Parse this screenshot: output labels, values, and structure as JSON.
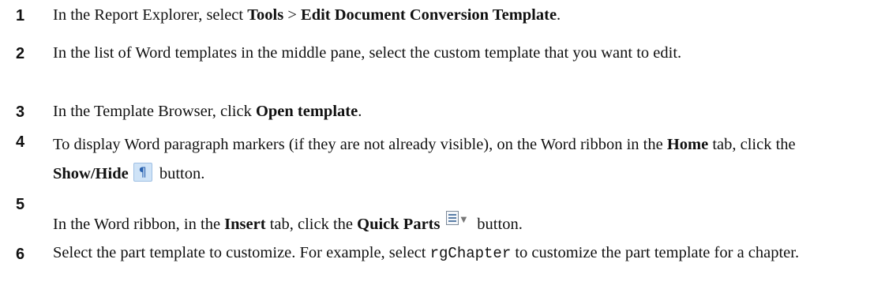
{
  "steps": [
    {
      "number": "1",
      "prefix": "In the Report Explorer, select ",
      "bold1": "Tools",
      "sep": " > ",
      "bold2": "Edit Document Conversion Template",
      "suffix": "."
    },
    {
      "number": "2",
      "text": "In the list of Word templates in the middle pane, select the custom template that you want to edit."
    },
    {
      "number": "3",
      "prefix": "In the Template Browser, click ",
      "bold": "Open template",
      "suffix": "."
    },
    {
      "number": "4",
      "prefix": "To display Word paragraph markers (if they are not already visible), on the Word ribbon in the ",
      "bold1": "Home",
      "mid": " tab, click the ",
      "bold2": "Show/Hide",
      "icon_glyph": "¶",
      "suffix": " button."
    },
    {
      "number": "5",
      "prefix": "In the Word ribbon, in the ",
      "bold1": "Insert",
      "mid": " tab, click the ",
      "bold2": "Quick Parts",
      "suffix": " button."
    },
    {
      "number": "6",
      "prefix": "Select the part template to customize. For example, select ",
      "code": "rgChapter",
      "suffix": " to customize the part template for a chapter."
    }
  ],
  "icons": {
    "show_hide": "pilcrow-icon",
    "quick_parts": "quick-parts-icon"
  },
  "colors": {
    "text": "#111111",
    "icon_blue": "#cfe3f7"
  }
}
